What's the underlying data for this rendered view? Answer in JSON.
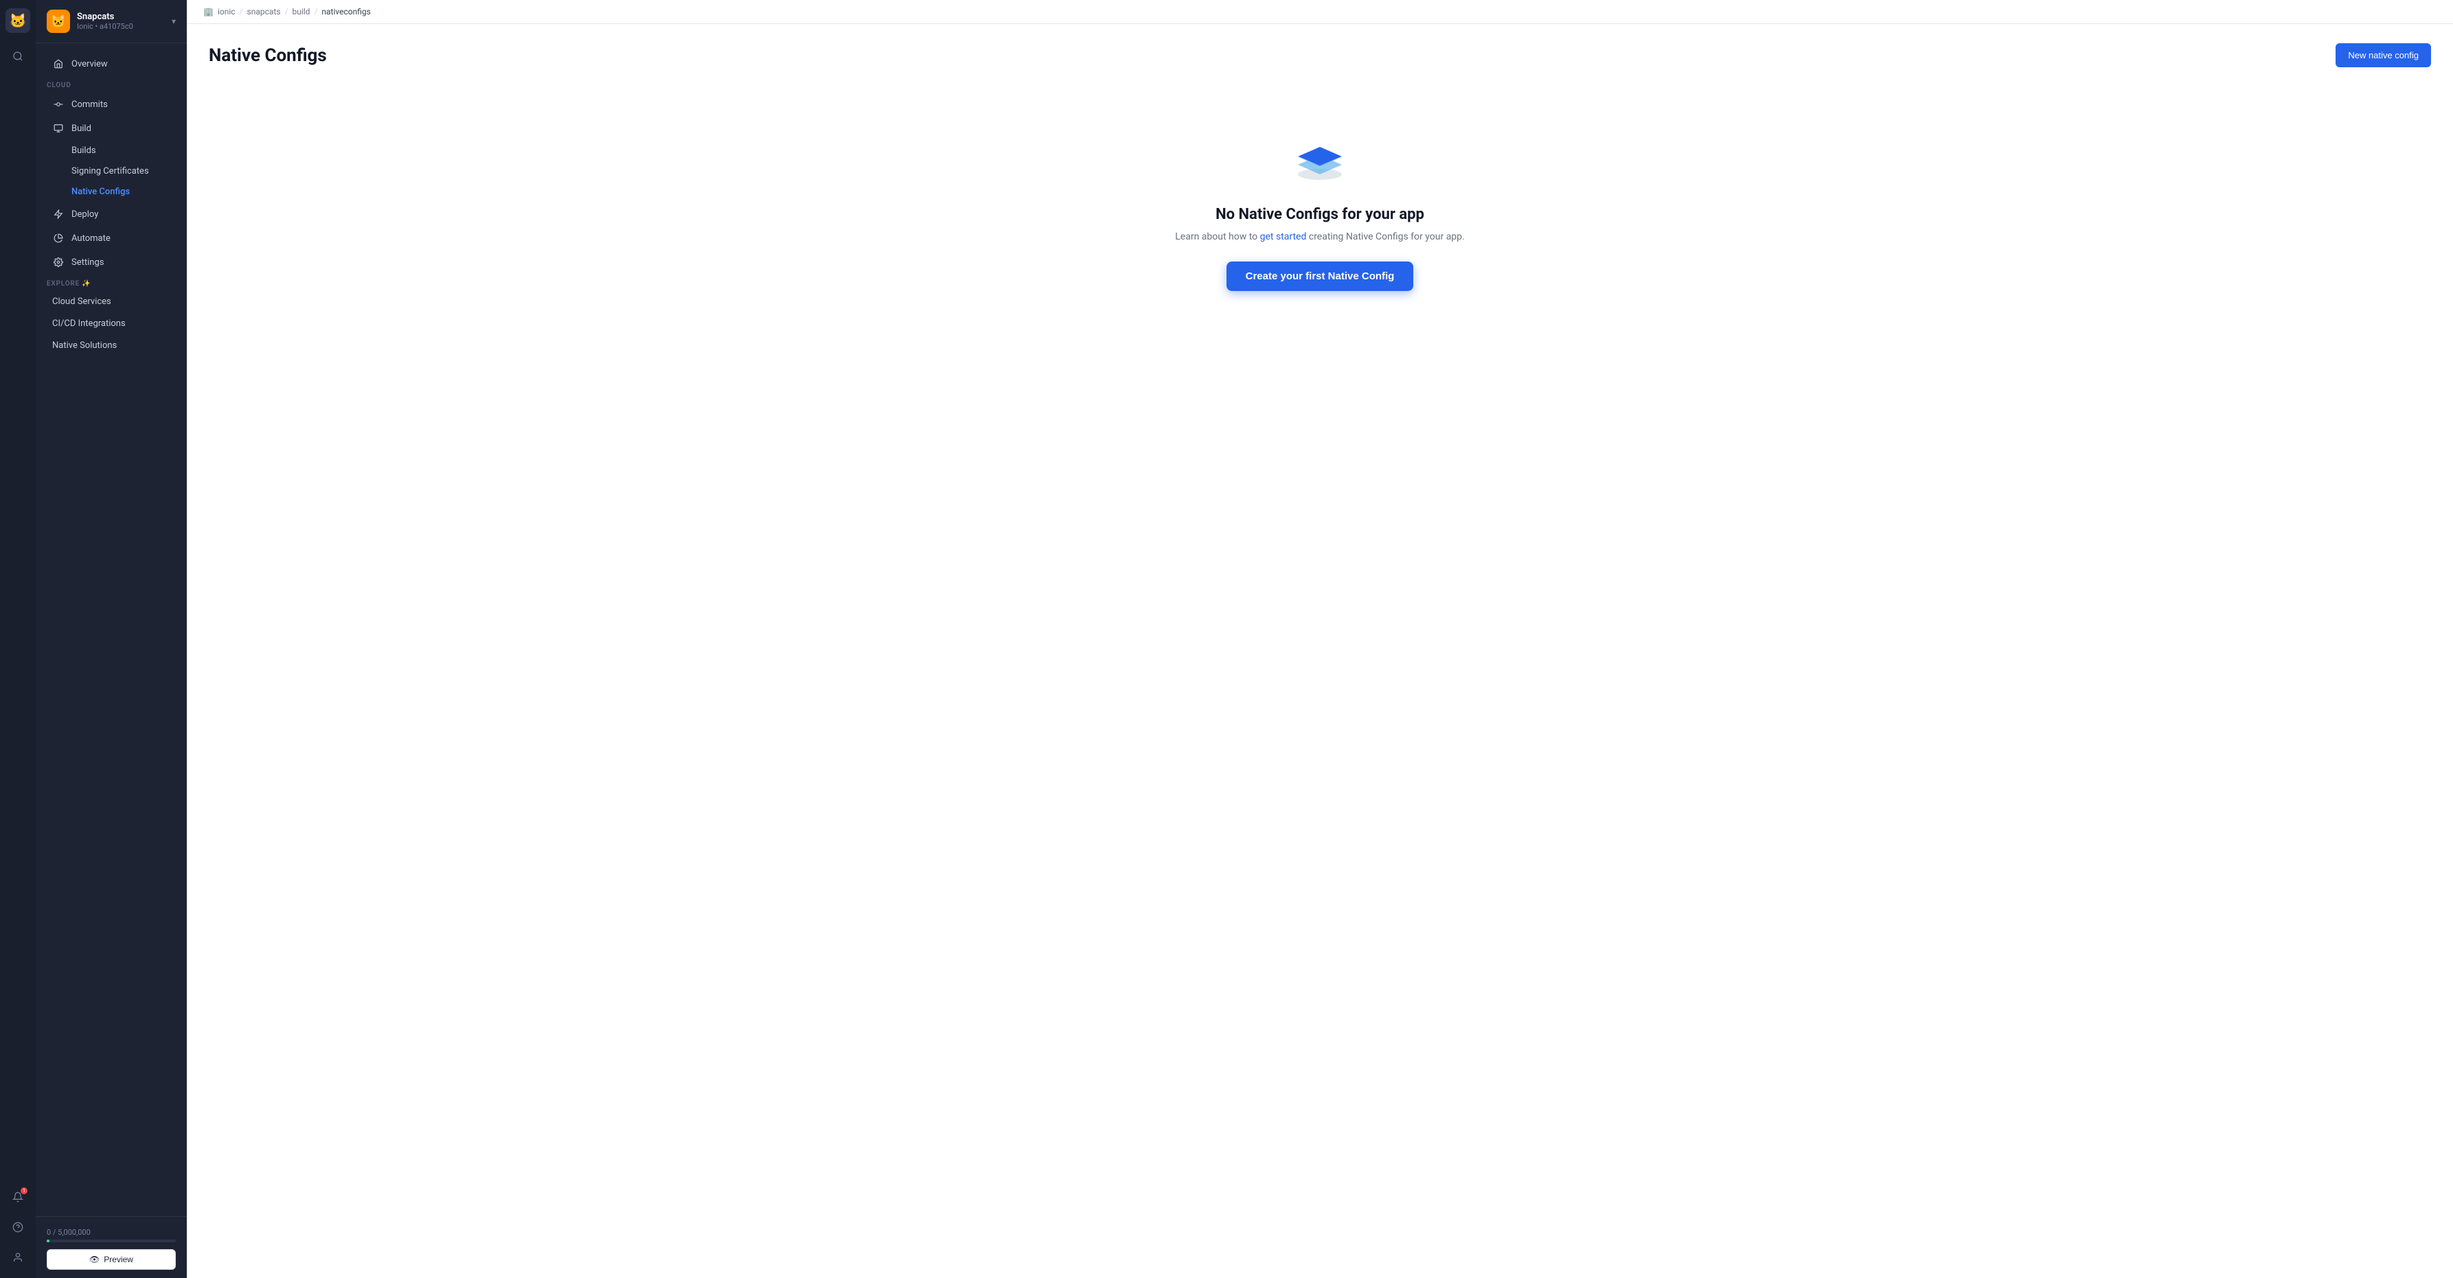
{
  "iconBar": {
    "logo": "🐱",
    "searchIcon": "🔍"
  },
  "sidebar": {
    "appName": "Snapcats",
    "appId": "Ionic • a41075c0",
    "appEmoji": "🐱",
    "overview": "Overview",
    "cloudSection": "CLOUD",
    "navItems": [
      {
        "id": "commits",
        "label": "Commits",
        "icon": "commits"
      },
      {
        "id": "build",
        "label": "Build",
        "icon": "build"
      }
    ],
    "buildSubItems": [
      {
        "id": "builds",
        "label": "Builds"
      },
      {
        "id": "signing-certificates",
        "label": "Signing Certificates"
      },
      {
        "id": "native-configs",
        "label": "Native Configs",
        "active": true
      }
    ],
    "deployLabel": "Deploy",
    "automateLabel": "Automate",
    "settingsLabel": "Settings",
    "exploreSection": "EXPLORE ✨",
    "exploreItems": [
      {
        "label": "Cloud Services"
      },
      {
        "label": "CI/CD Integrations"
      },
      {
        "label": "Native Solutions"
      }
    ],
    "usageText": "0 / 5,000,000",
    "previewLabel": "Preview"
  },
  "breadcrumb": {
    "icon": "🏢",
    "items": [
      "ionic",
      "snapcats",
      "build",
      "nativeconfigs"
    ]
  },
  "page": {
    "title": "Native Configs",
    "newButtonLabel": "New native config",
    "emptyTitle": "No Native Configs for your app",
    "emptyDescPrefix": "Learn about how to ",
    "emptyDescLink": "get started",
    "emptyDescSuffix": " creating Native Configs for your app.",
    "createButtonLabel": "Create your first Native Config"
  },
  "notifications": {
    "count": "1"
  }
}
